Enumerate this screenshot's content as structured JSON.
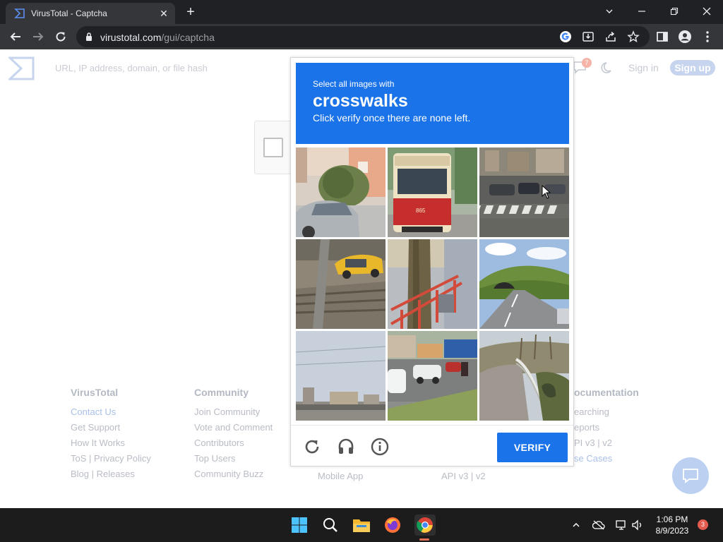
{
  "browser": {
    "tab_title": "VirusTotal - Captcha",
    "url_host": "virustotal.com",
    "url_path": "/gui/captcha"
  },
  "site": {
    "search_placeholder": "URL, IP address, domain, or file hash",
    "notification_count": "7",
    "sign_in": "Sign in",
    "sign_up": "Sign up"
  },
  "footer": {
    "columns": [
      {
        "heading": "VirusTotal",
        "links": [
          "Contact Us",
          "Get Support",
          "How It Works",
          "ToS | Privacy Policy",
          "Blog | Releases"
        ]
      },
      {
        "heading": "Community",
        "links": [
          "Join Community",
          "Vote and Comment",
          "Contributors",
          "Top Users",
          "Community Buzz"
        ]
      },
      {
        "heading": "",
        "links": [
          "Mobile App"
        ]
      },
      {
        "heading": "",
        "links": [
          "API v3 | v2"
        ]
      },
      {
        "heading": "ocumentation",
        "links": [
          "earching",
          "eports",
          "PI v3 | v2",
          "se Cases"
        ]
      }
    ]
  },
  "captcha": {
    "instruction": "Select all images with",
    "target": "crosswalks",
    "sub_instruction": "Click verify once there are none left.",
    "verify_label": "VERIFY",
    "tiles": [
      "house with shrub and silver car",
      "red and cream tram number 865",
      "street with crosswalk and cars",
      "yellow taxi behind pole",
      "tree trunk and red barrier",
      "highway tunnel through green hills",
      "overpass under grey sky",
      "city street with white cars and motorcycle",
      "curved road with guardrail"
    ],
    "tram_number": "865"
  },
  "taskbar": {
    "time": "1:06 PM",
    "date": "8/9/2023",
    "notification_count": "3"
  },
  "colors": {
    "captcha_blue": "#1a73e8",
    "chrome_dark": "#202124",
    "chrome_toolbar": "#35363a"
  }
}
